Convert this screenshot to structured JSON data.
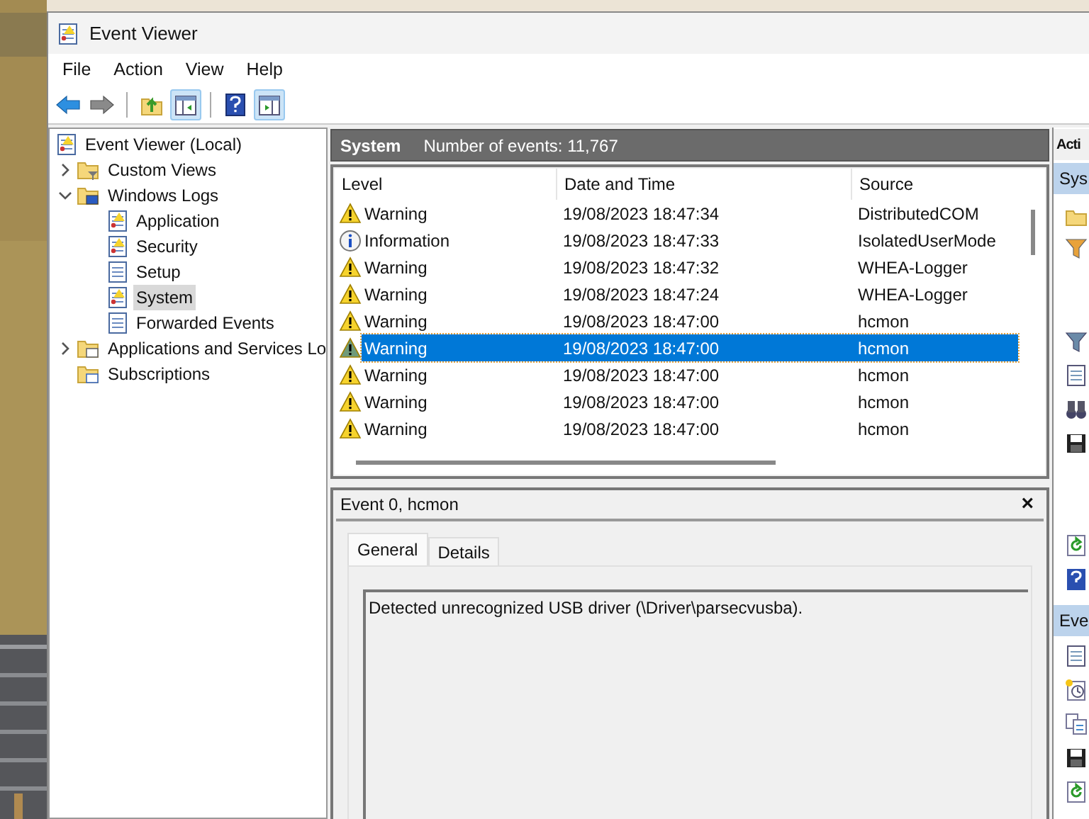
{
  "window": {
    "title": "Event Viewer"
  },
  "menu": [
    "File",
    "Action",
    "View",
    "Help"
  ],
  "toolbar": [
    {
      "kind": "back",
      "pressed": false
    },
    {
      "kind": "forward",
      "pressed": false
    },
    {
      "kind": "sep"
    },
    {
      "kind": "up",
      "pressed": false
    },
    {
      "kind": "tree",
      "pressed": true
    },
    {
      "kind": "sep"
    },
    {
      "kind": "help",
      "pressed": false
    },
    {
      "kind": "actions",
      "pressed": true
    }
  ],
  "tree": [
    {
      "label": "Event Viewer (Local)",
      "kind": "root",
      "selected": false,
      "children": [
        {
          "label": "Custom Views",
          "kind": "folder-filter",
          "expanded": false,
          "selected": false
        },
        {
          "label": "Windows Logs",
          "kind": "folder-window",
          "expanded": true,
          "selected": false,
          "children": [
            {
              "label": "Application",
              "kind": "log-warn",
              "selected": false
            },
            {
              "label": "Security",
              "kind": "log-warn",
              "selected": false
            },
            {
              "label": "Setup",
              "kind": "log",
              "selected": false
            },
            {
              "label": "System",
              "kind": "log-warn",
              "selected": true
            },
            {
              "label": "Forwarded Events",
              "kind": "log",
              "selected": false
            }
          ]
        },
        {
          "label": "Applications and Services Lo",
          "kind": "folder-plain",
          "expanded": false,
          "selected": false
        },
        {
          "label": "Subscriptions",
          "kind": "folder-sub",
          "selected": false
        }
      ]
    }
  ],
  "log_header": {
    "name": "System",
    "count": "Number of events: 11,767"
  },
  "table": {
    "columns": [
      "Level",
      "Date and Time",
      "Source"
    ],
    "rows": [
      {
        "level": "Warning",
        "kind": "warning",
        "date": "19/08/2023 18:47:34",
        "source": "DistributedCOM",
        "selected": false
      },
      {
        "level": "Information",
        "kind": "information",
        "date": "19/08/2023 18:47:33",
        "source": "IsolatedUserMode",
        "selected": false
      },
      {
        "level": "Warning",
        "kind": "warning",
        "date": "19/08/2023 18:47:32",
        "source": "WHEA-Logger",
        "selected": false
      },
      {
        "level": "Warning",
        "kind": "warning",
        "date": "19/08/2023 18:47:24",
        "source": "WHEA-Logger",
        "selected": false
      },
      {
        "level": "Warning",
        "kind": "warning",
        "date": "19/08/2023 18:47:00",
        "source": "hcmon",
        "selected": false
      },
      {
        "level": "Warning",
        "kind": "warning",
        "date": "19/08/2023 18:47:00",
        "source": "hcmon",
        "selected": true
      },
      {
        "level": "Warning",
        "kind": "warning",
        "date": "19/08/2023 18:47:00",
        "source": "hcmon",
        "selected": false
      },
      {
        "level": "Warning",
        "kind": "warning",
        "date": "19/08/2023 18:47:00",
        "source": "hcmon",
        "selected": false
      },
      {
        "level": "Warning",
        "kind": "warning",
        "date": "19/08/2023 18:47:00",
        "source": "hcmon",
        "selected": false
      }
    ]
  },
  "details": {
    "title": "Event 0, hcmon",
    "close": "×",
    "tabs": [
      {
        "label": "General",
        "selected": true
      },
      {
        "label": "Details",
        "selected": false
      }
    ],
    "message": "Detected unrecognized USB driver (\\Driver\\parsecvusba)."
  },
  "actions": {
    "title": "Acti",
    "sections": [
      "Sys",
      "Eve"
    ]
  }
}
